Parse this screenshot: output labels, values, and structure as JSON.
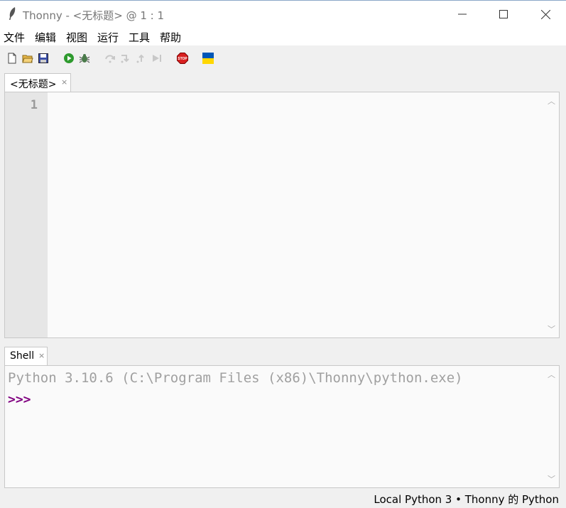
{
  "window": {
    "app_name": "Thonny",
    "title": "Thonny  -  <无标题>  @  1 : 1",
    "controls": [
      "minimize-icon",
      "maximize-icon",
      "close-icon"
    ]
  },
  "menu": {
    "items": [
      {
        "label": "文件"
      },
      {
        "label": "编辑"
      },
      {
        "label": "视图"
      },
      {
        "label": "运行"
      },
      {
        "label": "工具"
      },
      {
        "label": "帮助"
      }
    ]
  },
  "toolbar": {
    "icons": [
      "new-file-icon",
      "open-file-icon",
      "save-icon",
      "run-icon",
      "debug-icon",
      "step-over-icon",
      "step-into-icon",
      "step-out-icon",
      "resume-icon",
      "stop-icon",
      "ukraine-flag-icon"
    ],
    "stop_label": "STOP",
    "colors": {
      "run": "#2e9a2e",
      "stop": "#d82020",
      "flag_blue": "#0057b7",
      "flag_yellow": "#ffd700"
    }
  },
  "editor": {
    "tab_label": "<无标题>",
    "tab_close": "×",
    "line_numbers": [
      "1"
    ]
  },
  "shell": {
    "tab_label": "Shell",
    "tab_close": "×",
    "banner": "Python 3.10.6 (C:\\Program Files (x86)\\Thonny\\python.exe)",
    "prompt": ">>>",
    "prompt_color": "#800080"
  },
  "scroll_arrows": {
    "up": "︿",
    "down": "﹀"
  },
  "status": {
    "text": "Local Python 3  •  Thonny 的 Python"
  }
}
